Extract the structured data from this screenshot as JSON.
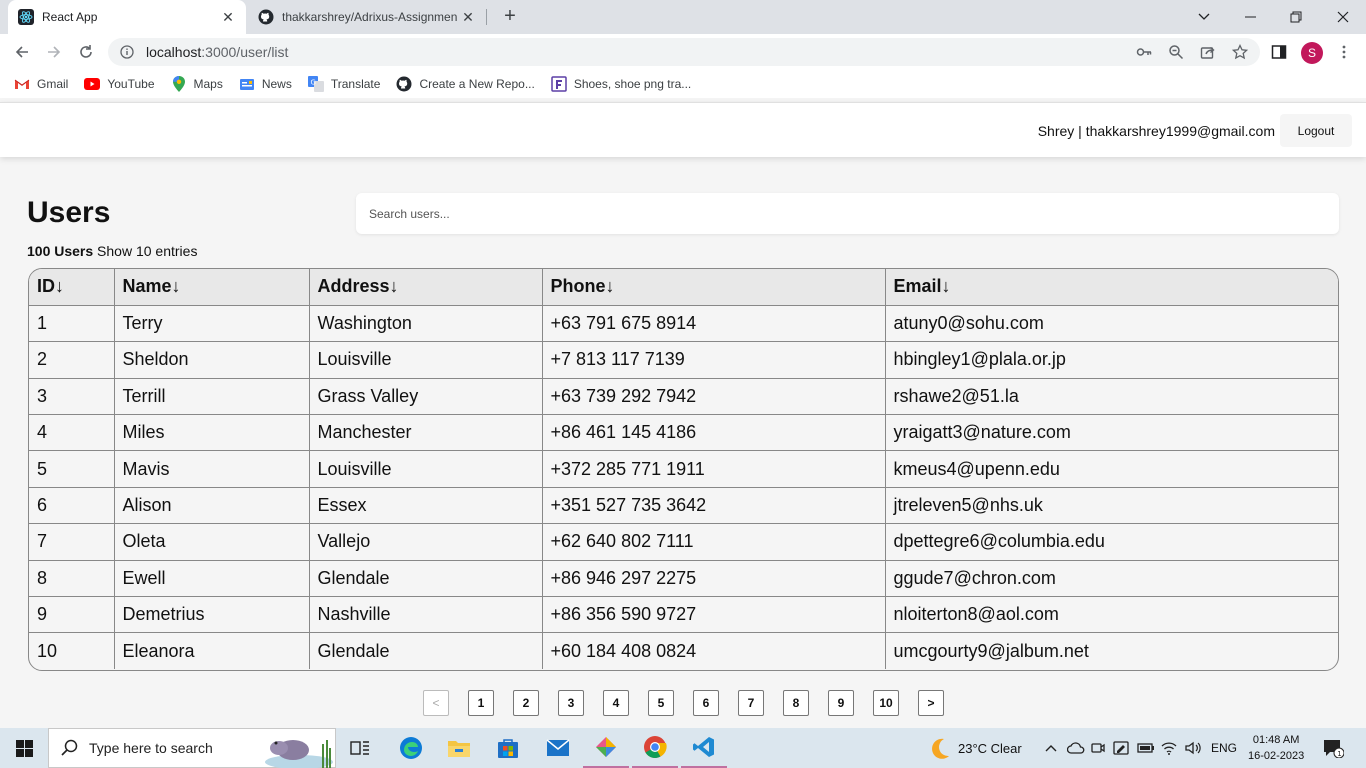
{
  "browser": {
    "tabs": [
      {
        "title": "React App",
        "active": true
      },
      {
        "title": "thakkarshrey/Adrixus-Assignmen",
        "active": false
      }
    ],
    "url_host": "localhost",
    "url_path": ":3000/user/list",
    "profile_initial": "S",
    "bookmarks": [
      "Gmail",
      "YouTube",
      "Maps",
      "News",
      "Translate",
      "Create a New Repo...",
      "Shoes, shoe png tra..."
    ]
  },
  "header": {
    "user_info": "Shrey | thakkarshrey1999@gmail.com",
    "logout_label": "Logout"
  },
  "main": {
    "title": "Users",
    "search_placeholder": "Search users...",
    "count_bold": "100 Users",
    "count_rest": " Show 10 entries",
    "columns": [
      "ID↓",
      "Name↓",
      "Address↓",
      "Phone↓",
      "Email↓"
    ],
    "rows": [
      [
        "1",
        "Terry",
        "Washington",
        "+63 791 675 8914",
        "atuny0@sohu.com"
      ],
      [
        "2",
        "Sheldon",
        "Louisville",
        "+7 813 117 7139",
        "hbingley1@plala.or.jp"
      ],
      [
        "3",
        "Terrill",
        "Grass Valley",
        "+63 739 292 7942",
        "rshawe2@51.la"
      ],
      [
        "4",
        "Miles",
        "Manchester",
        "+86 461 145 4186",
        "yraigatt3@nature.com"
      ],
      [
        "5",
        "Mavis",
        "Louisville",
        "+372 285 771 1911",
        "kmeus4@upenn.edu"
      ],
      [
        "6",
        "Alison",
        "Essex",
        "+351 527 735 3642",
        "jtreleven5@nhs.uk"
      ],
      [
        "7",
        "Oleta",
        "Vallejo",
        "+62 640 802 7111",
        "dpettegre6@columbia.edu"
      ],
      [
        "8",
        "Ewell",
        "Glendale",
        "+86 946 297 2275",
        "ggude7@chron.com"
      ],
      [
        "9",
        "Demetrius",
        "Nashville",
        "+86 356 590 9727",
        "nloiterton8@aol.com"
      ],
      [
        "10",
        "Eleanora",
        "Glendale",
        "+60 184 408 0824",
        "umcgourty9@jalbum.net"
      ]
    ],
    "pagination": {
      "prev": "<",
      "pages": [
        "1",
        "2",
        "3",
        "4",
        "5",
        "6",
        "7",
        "8",
        "9",
        "10"
      ],
      "next": ">"
    }
  },
  "taskbar": {
    "search_placeholder": "Type here to search",
    "weather": "23°C  Clear",
    "language": "ENG",
    "time": "01:48 AM",
    "date": "16-02-2023",
    "notification_count": "1"
  },
  "colors": {
    "profile": "#c2185b",
    "taskbar": "#dbe6ee",
    "page_bg": "#f5f5f5"
  }
}
